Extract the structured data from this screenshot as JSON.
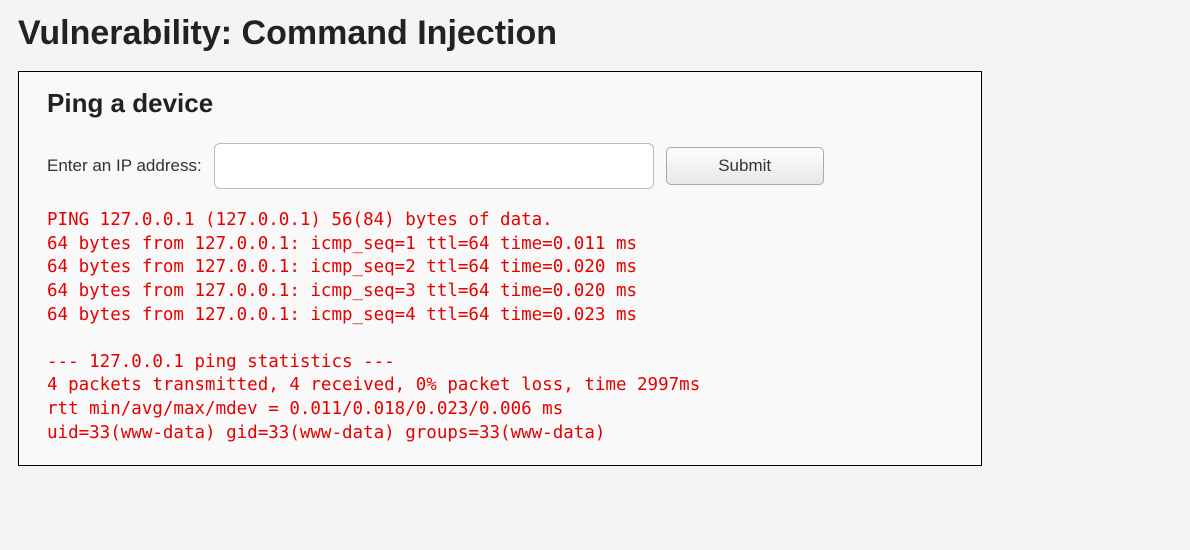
{
  "page": {
    "title": "Vulnerability: Command Injection"
  },
  "panel": {
    "heading": "Ping a device",
    "form": {
      "label": "Enter an IP address:",
      "input_value": "",
      "submit_label": "Submit"
    },
    "output": "PING 127.0.0.1 (127.0.0.1) 56(84) bytes of data.\n64 bytes from 127.0.0.1: icmp_seq=1 ttl=64 time=0.011 ms\n64 bytes from 127.0.0.1: icmp_seq=2 ttl=64 time=0.020 ms\n64 bytes from 127.0.0.1: icmp_seq=3 ttl=64 time=0.020 ms\n64 bytes from 127.0.0.1: icmp_seq=4 ttl=64 time=0.023 ms\n\n--- 127.0.0.1 ping statistics ---\n4 packets transmitted, 4 received, 0% packet loss, time 2997ms\nrtt min/avg/max/mdev = 0.011/0.018/0.023/0.006 ms\nuid=33(www-data) gid=33(www-data) groups=33(www-data)"
  }
}
